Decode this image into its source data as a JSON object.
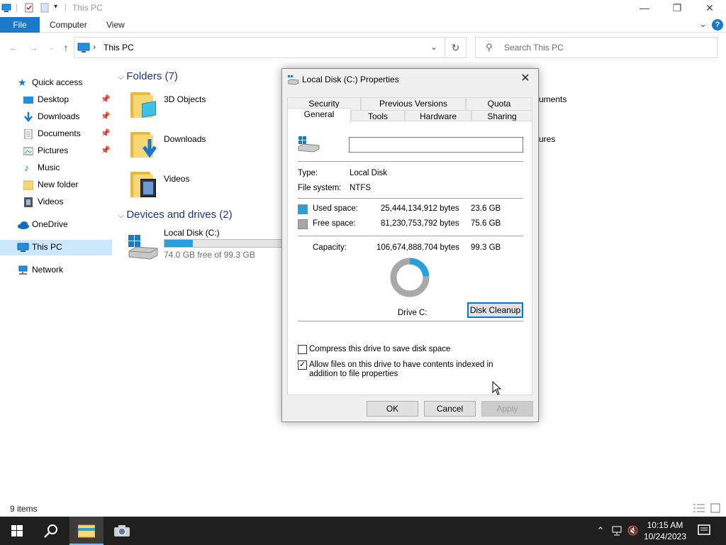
{
  "window": {
    "title": "This PC",
    "controls": {
      "minimize": "—",
      "maximize": "❐",
      "close": "✕"
    }
  },
  "ribbon": {
    "tabs": [
      "File",
      "Computer",
      "View"
    ],
    "collapse": "⌄",
    "help": "?"
  },
  "address": {
    "path": "This PC",
    "separator": "›",
    "search_placeholder": "Search This PC"
  },
  "sidebar": {
    "items": [
      {
        "label": "Quick access",
        "icon": "star-icon"
      },
      {
        "label": "Desktop",
        "icon": "desktop-icon",
        "pinned": true
      },
      {
        "label": "Downloads",
        "icon": "download-icon",
        "pinned": true
      },
      {
        "label": "Documents",
        "icon": "document-icon",
        "pinned": true
      },
      {
        "label": "Pictures",
        "icon": "pictures-icon",
        "pinned": true
      },
      {
        "label": "Music",
        "icon": "music-icon"
      },
      {
        "label": "New folder",
        "icon": "folder-icon"
      },
      {
        "label": "Videos",
        "icon": "videos-icon"
      },
      {
        "label": "OneDrive",
        "icon": "cloud-icon"
      },
      {
        "label": "This PC",
        "icon": "computer-icon",
        "selected": true
      },
      {
        "label": "Network",
        "icon": "network-icon"
      }
    ]
  },
  "content": {
    "folders_header": "Folders (7)",
    "folders": [
      {
        "label": "3D Objects"
      },
      {
        "label": "Downloads"
      },
      {
        "label": "Videos"
      },
      {
        "label": "uments"
      },
      {
        "label": "ures"
      }
    ],
    "devices_header": "Devices and drives (2)",
    "drive": {
      "label": "Local Disk (C:)",
      "free_text": "74.0 GB free of 99.3 GB",
      "used_fraction": 0.238
    }
  },
  "status": {
    "items": "9 items"
  },
  "dialog": {
    "title": "Local Disk (C:) Properties",
    "tabs_row1": [
      "Security",
      "Previous Versions",
      "Quota"
    ],
    "tabs_row2": [
      "General",
      "Tools",
      "Hardware",
      "Sharing"
    ],
    "name_value": "",
    "type_label": "Type:",
    "type_value": "Local Disk",
    "fs_label": "File system:",
    "fs_value": "NTFS",
    "used_label": "Used space:",
    "used_bytes": "25,444,134,912 bytes",
    "used_gb": "23.6 GB",
    "free_label": "Free space:",
    "free_bytes": "81,230,753,792 bytes",
    "free_gb": "75.6 GB",
    "capacity_label": "Capacity:",
    "capacity_bytes": "106,674,888,704 bytes",
    "capacity_gb": "99.3 GB",
    "used_fraction": 0.238,
    "drive_label": "Drive C:",
    "cleanup_button": "Disk Cleanup",
    "compress_label": "Compress this drive to save disk space",
    "compress_checked": false,
    "index_label": "Allow files on this drive to have contents indexed in addition to file properties",
    "index_checked": true,
    "ok": "OK",
    "cancel": "Cancel",
    "apply": "Apply",
    "colors": {
      "used": "#26a0da",
      "free": "#a8a8a8"
    }
  },
  "taskbar": {
    "time": "10:15 AM",
    "date": "10/24/2023"
  }
}
